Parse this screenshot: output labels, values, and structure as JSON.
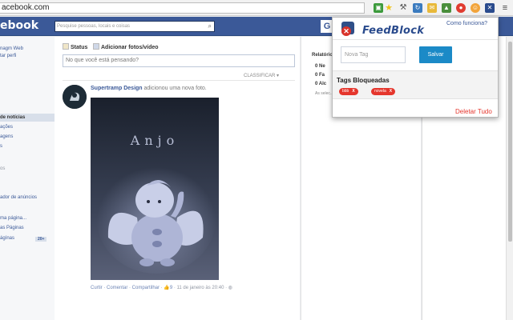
{
  "browser": {
    "url": "acebook.com"
  },
  "extensions": [
    {
      "icon": "green-square-icon",
      "color": "#3c9a3c"
    },
    {
      "icon": "star-icon",
      "color": "#f0c419"
    },
    {
      "icon": "tools-icon",
      "color": "#555555"
    },
    {
      "icon": "refresh-icon",
      "color": "#3b7bbf"
    },
    {
      "icon": "mail-icon",
      "color": "#e8b93a"
    },
    {
      "icon": "drive-icon",
      "color": "#4a8f3c"
    },
    {
      "icon": "record-icon",
      "color": "#e03b2f"
    },
    {
      "icon": "smiley-icon",
      "color": "#f2a43a"
    },
    {
      "icon": "feedblock-icon",
      "color": "#2a4b8d"
    },
    {
      "icon": "menu-icon",
      "color": "#444444"
    }
  ],
  "facebook": {
    "logo": "ebook",
    "search_placeholder": "Pesquise pessoas, locais e coisas",
    "header_right": "G"
  },
  "leftnav": {
    "items": [
      "nagm Web",
      "tar perfi",
      "de notícias",
      "ações",
      "agens",
      "s",
      "os",
      "ador de anúncios",
      "ma página...",
      "as Páginas",
      "ágínas"
    ],
    "count": "20+"
  },
  "feed": {
    "tab_status": "Status",
    "tab_photo": "Adicionar fotos/vídeo",
    "composer_placeholder": "No que você está pensando?",
    "sort_label": "CLASSIFICAR ▾",
    "post": {
      "author": "Supertramp Design",
      "action": " adicionou uma nova foto.",
      "photo_caption": "Anjo",
      "meta_actions": "Curtir · Comentar · Compartilhar · ",
      "meta_likes": "👍9",
      "meta_time": " · 11 de janeiro às 20:40 · "
    }
  },
  "rightcol": {
    "title": "Relatório",
    "rows": [
      "0 Ne",
      "0 Fa",
      "0 Alc"
    ],
    "note": "As selec... adicionar..."
  },
  "popup": {
    "title": "FeedBlock",
    "help_link": "Como funciona?",
    "input_placeholder": "Nova Tag",
    "save_label": "Salvar",
    "blocked_title": "Tags Bloqueadas",
    "tags": [
      "bbb",
      "novela"
    ],
    "tag_remove": "X",
    "clear_all": "Deletar Tudo",
    "accent": "#e5362d",
    "save_color": "#1b8ac7"
  }
}
